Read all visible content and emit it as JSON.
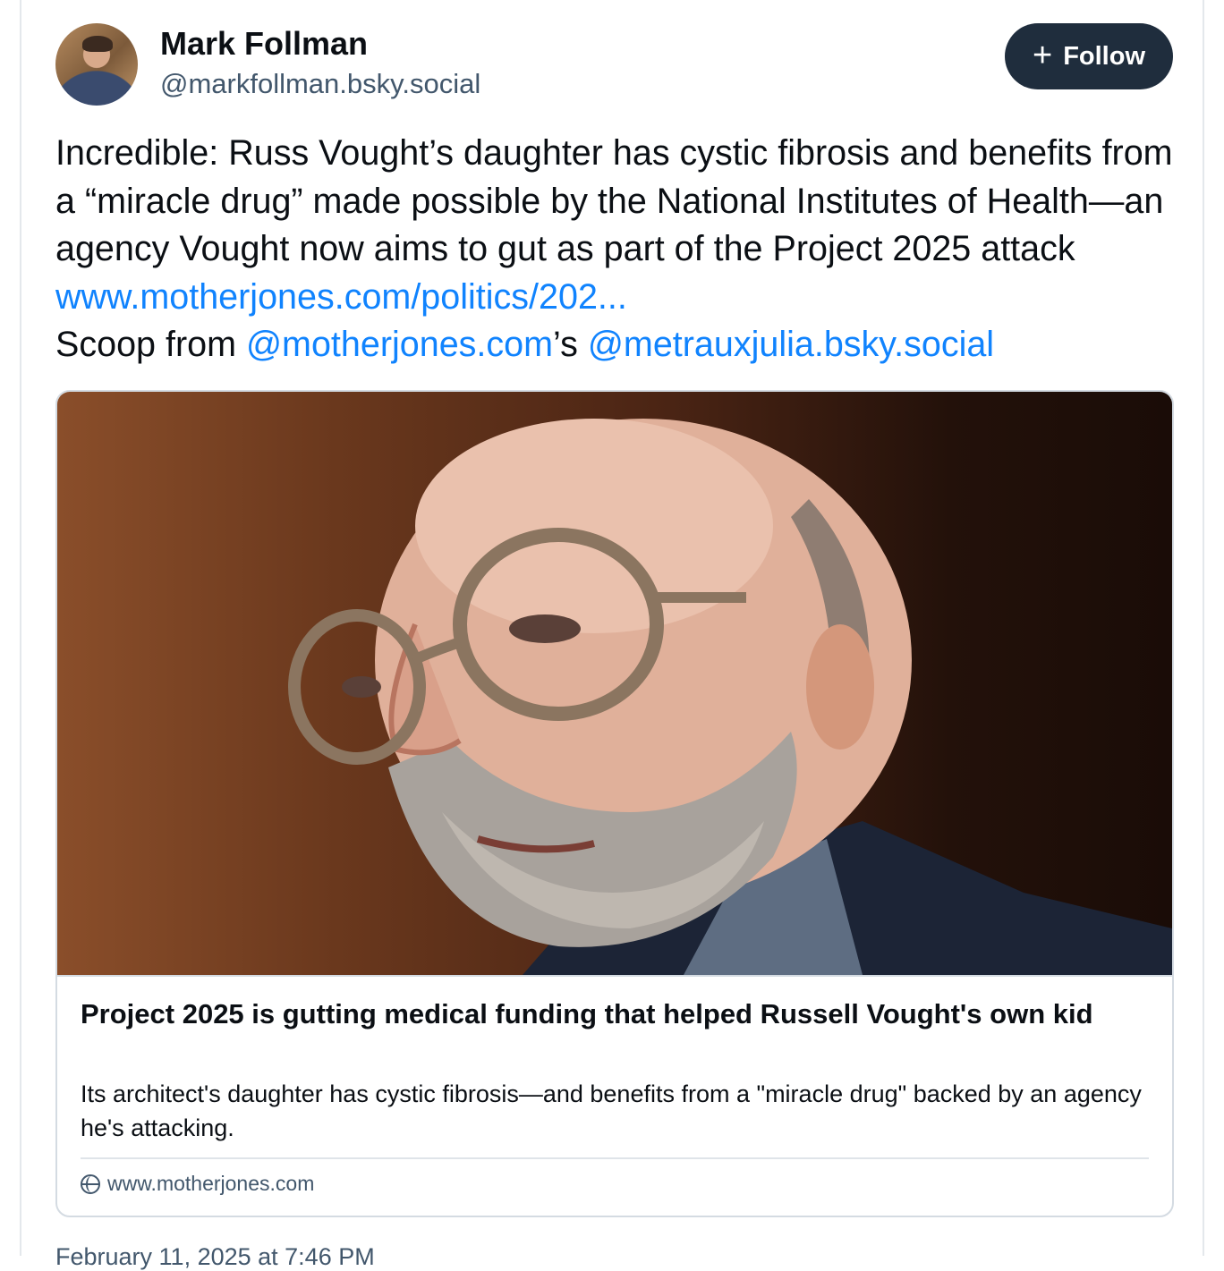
{
  "author": {
    "display_name": "Mark Follman",
    "handle": "@markfollman.bsky.social"
  },
  "follow_button": {
    "icon": "plus-icon",
    "label": "Follow"
  },
  "post": {
    "text_1": "Incredible: Russ Vought’s daughter has cystic fibrosis and benefits from a “miracle drug” made possible by the National Institutes of Health—an agency Vought now aims to gut as part of the Project 2025 attack ",
    "link_url": "www.motherjones.com/politics/202...",
    "text_2": "Scoop from ",
    "mention_1": "@motherjones.com",
    "text_3": "’s ",
    "mention_2": "@metrauxjulia.bsky.social"
  },
  "embed": {
    "image_alt": "photo-of-man-with-glasses",
    "title": "Project 2025 is gutting medical funding that helped Russell Vought's own kid",
    "description": "Its architect's daughter has cystic fibrosis—and benefits from a \"miracle drug\" backed by an agency he's attacking.",
    "domain_icon": "globe-icon",
    "domain": "www.motherjones.com"
  },
  "footer": {
    "timestamp": "February 11, 2025 at 7:46 PM"
  },
  "colors": {
    "link": "#1083fe",
    "follow_bg": "#1f2d3d",
    "muted": "#42576c"
  }
}
